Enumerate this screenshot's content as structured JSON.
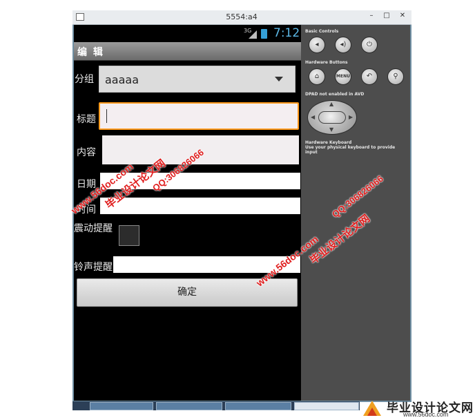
{
  "window": {
    "title": "5554:a4",
    "controls": [
      "–",
      "□",
      "✕"
    ]
  },
  "statusbar": {
    "network": "3G",
    "time": "7:12"
  },
  "app": {
    "title": "编 辑"
  },
  "form": {
    "group_label": "分组",
    "group_value": "aaaaa",
    "title_label": "标题",
    "title_value": "",
    "content_label": "内容",
    "content_value": "",
    "date_label": "日期",
    "date_value": "",
    "time_label": "时间",
    "time_value": "",
    "vibrate_label": "震动提醒",
    "vibrate_checked": false,
    "ringtone_label": "铃声提醒",
    "ringtone_value": "",
    "submit_label": "确定"
  },
  "panel": {
    "basic_controls": "Basic Controls",
    "hardware_buttons": "Hardware Buttons",
    "menu_label": "MENU",
    "dpad_note": "DPAD not enabled in AVD",
    "keyboard_title": "Hardware Keyboard",
    "keyboard_note": "Use your physical keyboard to provide input"
  },
  "watermarks": {
    "site_name": "毕业设计论文网",
    "url": "www.56doc.com",
    "qq": "QQ:306826066"
  },
  "logo": {
    "text": "毕业设计论文网",
    "url": "www.56doc.com"
  },
  "colors": {
    "focus_border": "#ff9a1c",
    "clock": "#5cb8e6",
    "watermark": "#e01e1e"
  }
}
